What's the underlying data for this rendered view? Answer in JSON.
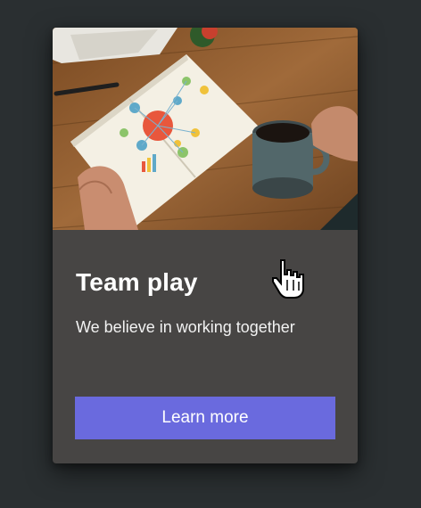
{
  "card": {
    "image_icon": "team-workspace-photo",
    "title": "Team play",
    "description": "We believe in working together",
    "button_label": "Learn more"
  },
  "colors": {
    "page_background": "#2a2f31",
    "card_background": "#474544",
    "button_background": "#6a6ade",
    "text": "#ffffff"
  },
  "cursor": {
    "icon": "hand-pointer-icon"
  }
}
